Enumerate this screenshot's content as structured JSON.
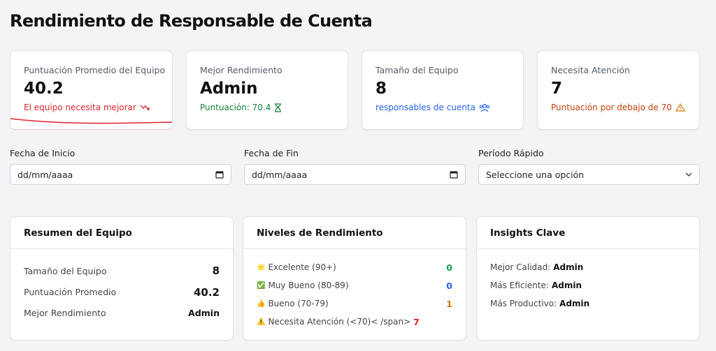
{
  "page": {
    "title": "Rendimiento de Responsable de Cuenta"
  },
  "stats": [
    {
      "label": "Puntuación Promedio del Equipo",
      "value": "40.2",
      "note": "El equipo necesita mejorar",
      "note_color": "#e0242f",
      "icon": "trending-down-icon"
    },
    {
      "label": "Mejor Rendimiento",
      "value": "Admin",
      "note": "Puntuación: 70.4",
      "note_color": "#15803d",
      "icon": "hourglass-icon"
    },
    {
      "label": "Tamaño del Equipo",
      "value": "8",
      "note": "responsables de cuenta",
      "note_color": "#2563eb",
      "icon": "users-icon"
    },
    {
      "label": "Necesita Atención",
      "value": "7",
      "note": "Puntuación por debajo de 70",
      "note_color": "#c2410c",
      "icon": "warning-icon"
    }
  ],
  "filters": {
    "start": {
      "label": "Fecha de Inicio",
      "value": "dd/mm/aaaa"
    },
    "end": {
      "label": "Fecha de Fin",
      "value": "dd/mm/aaaa"
    },
    "quick": {
      "label": "Período Rápido",
      "value": "Seleccione una opción"
    }
  },
  "summary": {
    "title": "Resumen del Equipo",
    "rows": [
      {
        "label": "Tamaño del Equipo",
        "value": "8"
      },
      {
        "label": "Puntuación Promedio",
        "value": "40.2"
      },
      {
        "label": "Mejor Rendimiento",
        "value": "Admin"
      }
    ]
  },
  "levels": {
    "title": "Niveles de Rendimiento",
    "rows": [
      {
        "emoji": "🌟",
        "label": "Excelente (90+)",
        "count": "0",
        "color": "#16a34a"
      },
      {
        "emoji": "✅",
        "label": "Muy Bueno (80-89)",
        "count": "0",
        "color": "#2563eb"
      },
      {
        "emoji": "👍",
        "label": "Bueno (70-79)",
        "count": "1",
        "color": "#d97706"
      },
      {
        "emoji": "⚠️",
        "label": "Necesita Atención (<70)< /span>",
        "count": "7",
        "color": "#dc2626"
      }
    ]
  },
  "insights": {
    "title": "Insights Clave",
    "rows": [
      {
        "label": "Mejor Calidad:",
        "value": "Admin"
      },
      {
        "label": "Más Eficiente:",
        "value": "Admin"
      },
      {
        "label": "Más Productivo:",
        "value": "Admin"
      }
    ]
  }
}
